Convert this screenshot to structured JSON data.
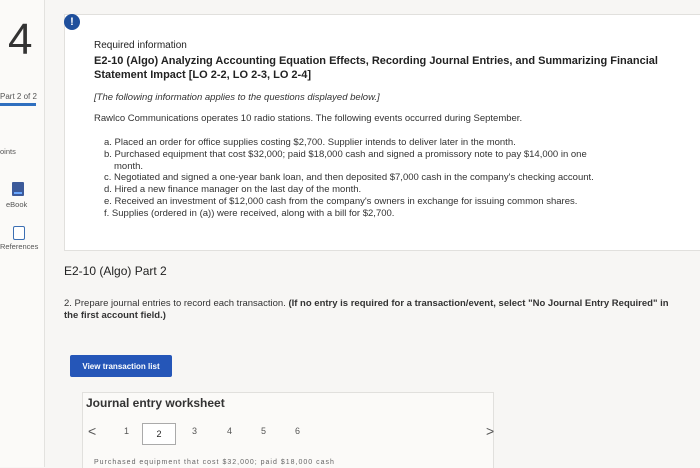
{
  "sidebar": {
    "question_number": "4",
    "part_label": "Part 2 of 2",
    "points_label": "oints",
    "ebook_label": "eBook",
    "references_label": "References"
  },
  "info": {
    "alert_glyph": "!",
    "heading": "Required information",
    "title": "E2-10 (Algo) Analyzing Accounting Equation Effects, Recording Journal Entries, and Summarizing Financial Statement Impact [LO 2-2, LO 2-3, LO 2-4]",
    "note": "[The following information applies to the questions displayed below.]",
    "intro": "Rawlco Communications operates 10 radio stations. The following events occurred during September.",
    "events": [
      "a. Placed an order for office supplies costing $2,700. Supplier intends to deliver later in the month.",
      "b. Purchased equipment that cost $32,000; paid $18,000 cash and signed a promissory note to pay $14,000 in one",
      "month.",
      "c. Negotiated and signed a one-year bank loan, and then deposited $7,000 cash in the company's checking account.",
      "d. Hired a new finance manager on the last day of the month.",
      "e. Received an investment of $12,000 cash from the company's owners in exchange for issuing common shares.",
      "f. Supplies (ordered in (a)) were received, along with a bill for $2,700."
    ]
  },
  "part2": {
    "title": "E2-10 (Algo) Part 2",
    "instruction_plain": "2. Prepare journal entries to record each transaction.",
    "instruction_bold": "(If no entry is required for a transaction/event, select \"No Journal Entry Required\" in the first account field.)",
    "view_button": "View transaction list"
  },
  "worksheet": {
    "title": "Journal entry worksheet",
    "prev": "<",
    "next": ">",
    "pages": [
      "1",
      "2",
      "3",
      "4",
      "5",
      "6"
    ],
    "active_page": "2",
    "cut_text": "Purchased equipment that cost $32,000; paid $18,000 cash"
  }
}
